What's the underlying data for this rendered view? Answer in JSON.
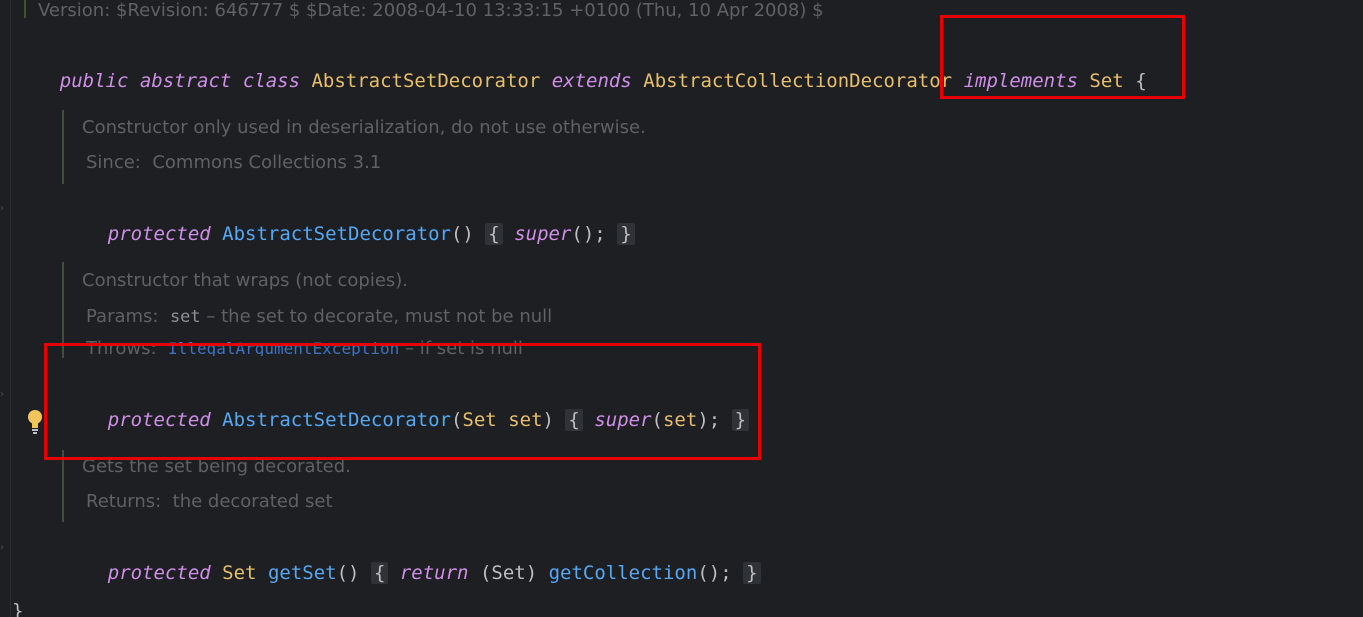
{
  "header_comment": "Version: $Revision: 646777 $ $Date: 2008-04-10 13:33:15 +0100 (Thu, 10 Apr 2008) $",
  "class_decl": {
    "kw_public": "public",
    "kw_abstract": "abstract",
    "kw_class": "class",
    "name": "AbstractSetDecorator",
    "kw_extends": "extends",
    "parent": "AbstractCollectionDecorator",
    "kw_implements": "implements",
    "iface": "Set",
    "open_brace": "{"
  },
  "doc1": {
    "text": "Constructor only used in deserialization, do not use otherwise.",
    "since_label": "Since:",
    "since_value": "Commons Collections 3.1"
  },
  "ctor1": {
    "kw_protected": "protected",
    "name": "AbstractSetDecorator",
    "parens": "()",
    "open": "{",
    "kw_super": "super",
    "call": "();",
    "close": "}"
  },
  "doc2": {
    "text": "Constructor that wraps (not copies).",
    "params_label": "Params:",
    "params_name": "set",
    "params_desc": "– the set to decorate, must not be null",
    "throws_label": "Throws:",
    "throws_type": "IllegalArgumentException",
    "throws_desc": "– if set is null"
  },
  "ctor2": {
    "kw_protected": "protected",
    "name": "AbstractSetDecorator",
    "lparen": "(",
    "ptype": "Set",
    "pname": "set",
    "rparen": ")",
    "open": "{",
    "kw_super": "super",
    "call_open": "(",
    "arg": "set",
    "call_close": ");",
    "close": "}"
  },
  "doc3": {
    "text": "Gets the set being decorated.",
    "returns_label": "Returns:",
    "returns_value": "the decorated set"
  },
  "method": {
    "kw_protected": "protected",
    "rtype": "Set",
    "name": "getSet",
    "parens": "()",
    "open": "{",
    "kw_return": "return",
    "cast": "(Set)",
    "call": "getCollection",
    "call_parens": "();",
    "close": "}"
  },
  "closing_brace": "}",
  "colors": {
    "background": "#1e1f22",
    "keyword": "#cf8ee8",
    "class_name": "#e8bf6a",
    "method_name": "#56a8f5",
    "doc_text": "#5f6166",
    "highlight_box": "#e60000",
    "bulb": "#f2c55c"
  },
  "icons": [
    "lightbulb-icon",
    "fold-arrow-icon"
  ]
}
